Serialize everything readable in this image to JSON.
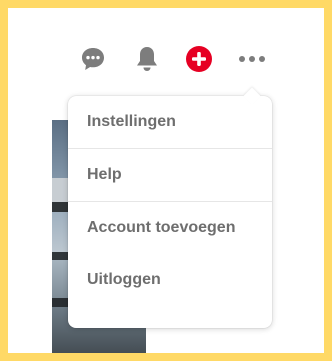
{
  "header": {
    "icons": [
      {
        "name": "messages-icon",
        "color": "#7d7d7d"
      },
      {
        "name": "notifications-bell-icon",
        "color": "#7d7d7d"
      },
      {
        "name": "create-plus-icon",
        "color": "#e60023"
      },
      {
        "name": "more-options-icon",
        "color": "#7d7d7d"
      }
    ]
  },
  "menu": {
    "items": [
      {
        "label": "Instellingen"
      },
      {
        "label": "Help"
      },
      {
        "label": "Account toevoegen"
      },
      {
        "label": "Uitloggen"
      }
    ]
  },
  "colors": {
    "frame_border": "#ffd966",
    "accent": "#e60023",
    "menu_text": "#6e6e6e"
  }
}
